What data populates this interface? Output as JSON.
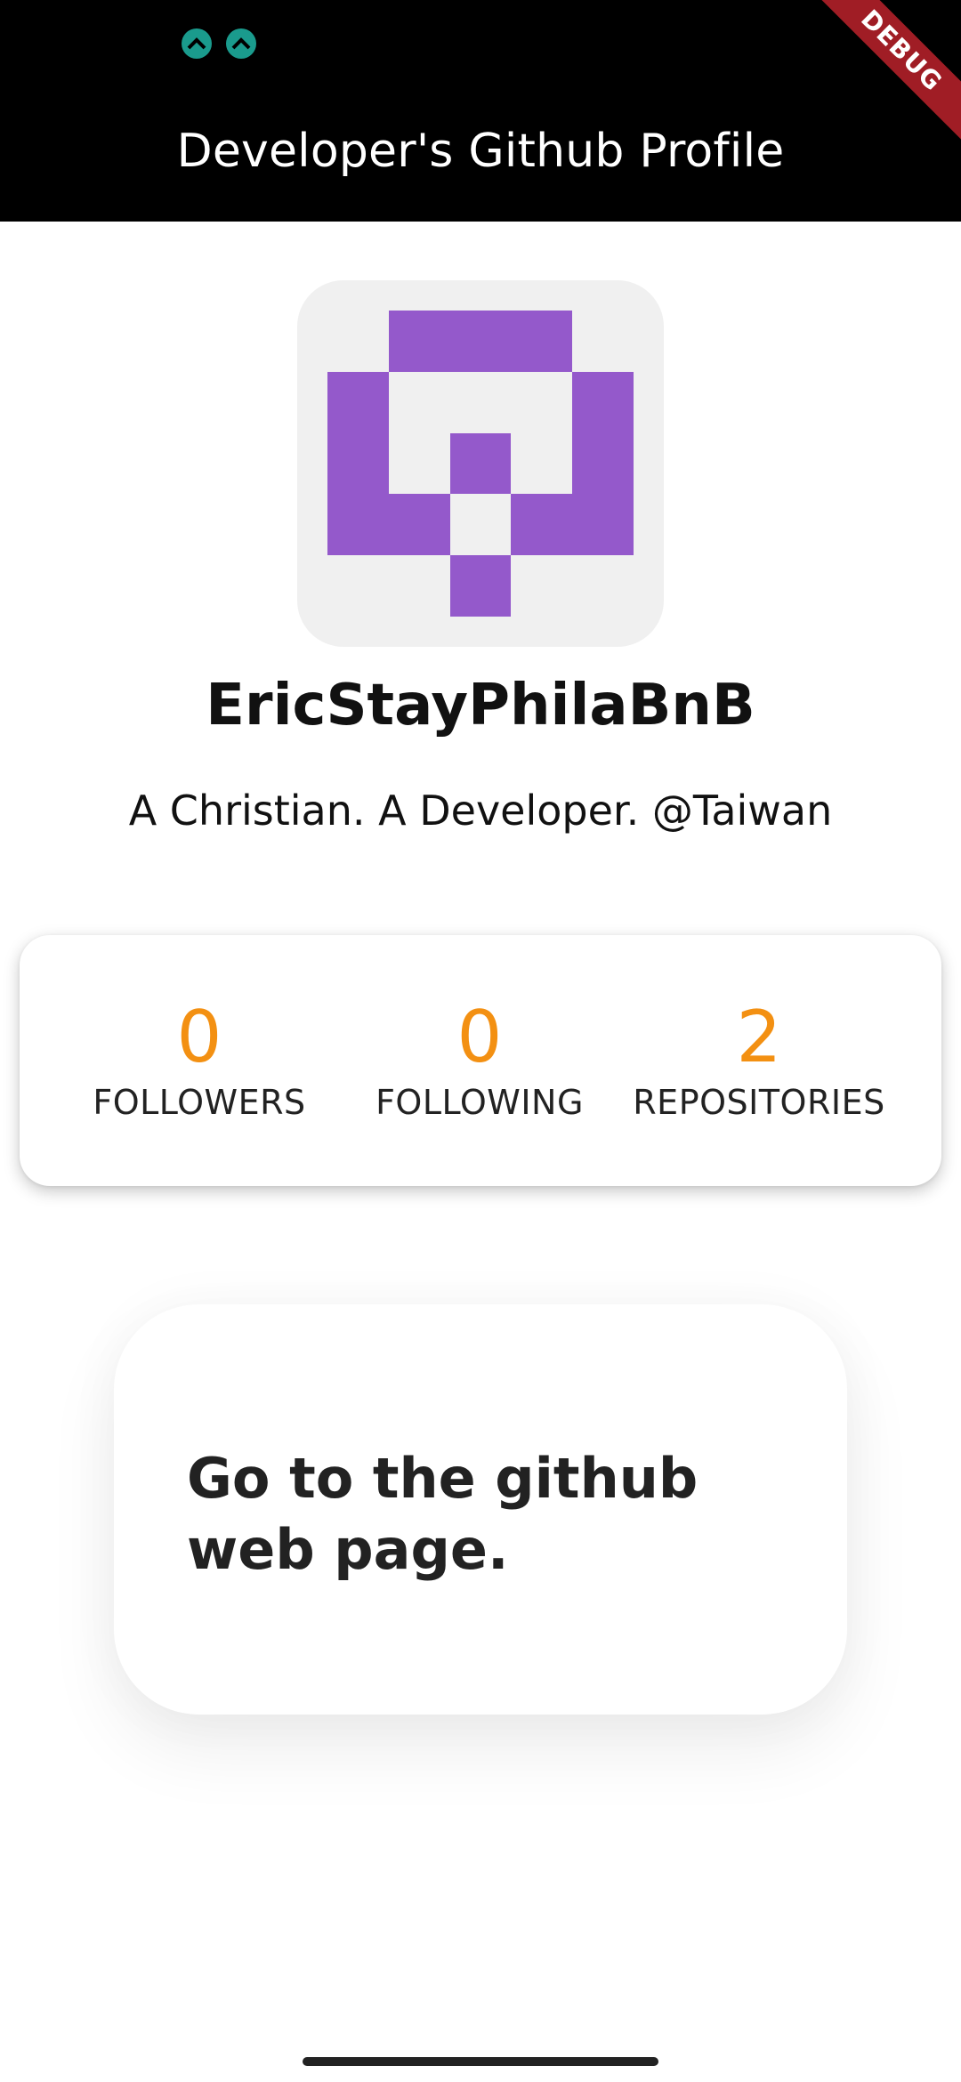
{
  "app_bar": {
    "title": "Developer's Github Profile",
    "debug_label": "DEBUG",
    "background": "#000000"
  },
  "status_bar": {
    "icons": [
      "notification-icon",
      "notification-icon"
    ],
    "icon_color": "#1a9b8d"
  },
  "profile": {
    "avatar_icon": "identicon-avatar",
    "avatar_color": "#9459cb",
    "username": "EricStayPhilaBnB",
    "bio": "A Christian. A Developer. @Taiwan"
  },
  "stats": {
    "value_color": "#f39012",
    "items": [
      {
        "value": "0",
        "label": "FOLLOWERS"
      },
      {
        "value": "0",
        "label": "FOLLOWING"
      },
      {
        "value": "2",
        "label": "REPOSITORIES"
      }
    ]
  },
  "github_link": {
    "text": "Go to the github web page."
  }
}
